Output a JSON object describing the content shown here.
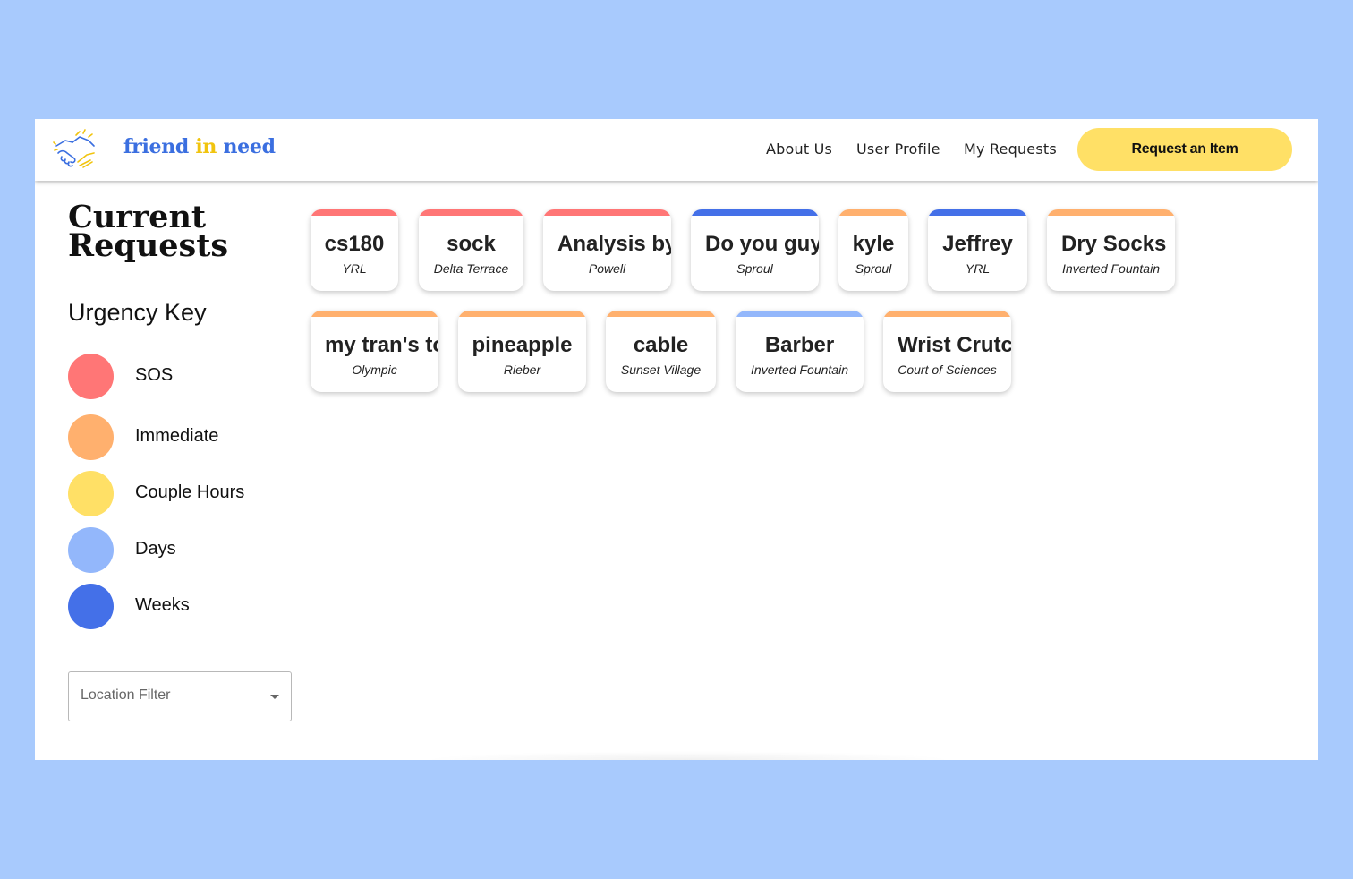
{
  "brand": {
    "part1": "friend",
    "part2": "in",
    "part3": "need"
  },
  "nav": {
    "about": "About Us",
    "profile": "User Profile",
    "requests": "My Requests",
    "cta": "Request an Item"
  },
  "sidebar": {
    "title": "Current Requests",
    "key_title": "Urgency Key",
    "key": [
      {
        "label": "SOS",
        "color": "#ff7676"
      },
      {
        "label": "Immediate",
        "color": "#ffb06e"
      },
      {
        "label": "Couple Hours",
        "color": "#ffe066"
      },
      {
        "label": "Days",
        "color": "#93b7fb"
      },
      {
        "label": "Weeks",
        "color": "#4470e8"
      }
    ],
    "filter_placeholder": "Location Filter"
  },
  "cards": [
    {
      "title": "cs180",
      "location": "YRL",
      "urgency": "SOS"
    },
    {
      "title": "sock",
      "location": "Delta Terrace",
      "urgency": "SOS"
    },
    {
      "title": "Analysis by",
      "location": "Powell",
      "urgency": "SOS"
    },
    {
      "title": "Do you guy",
      "location": "Sproul",
      "urgency": "Weeks"
    },
    {
      "title": "kyle",
      "location": "Sproul",
      "urgency": "Immediate"
    },
    {
      "title": "Jeffrey",
      "location": "YRL",
      "urgency": "Weeks"
    },
    {
      "title": "Dry Socks",
      "location": "Inverted Fountain",
      "urgency": "Immediate"
    },
    {
      "title": "my tran's to",
      "location": "Olympic",
      "urgency": "Immediate"
    },
    {
      "title": "pineapple",
      "location": "Rieber",
      "urgency": "Immediate"
    },
    {
      "title": "cable",
      "location": "Sunset Village",
      "urgency": "Immediate"
    },
    {
      "title": "Barber",
      "location": "Inverted Fountain",
      "urgency": "Days"
    },
    {
      "title": "Wrist Crutc",
      "location": "Court of Sciences",
      "urgency": "Immediate"
    }
  ]
}
